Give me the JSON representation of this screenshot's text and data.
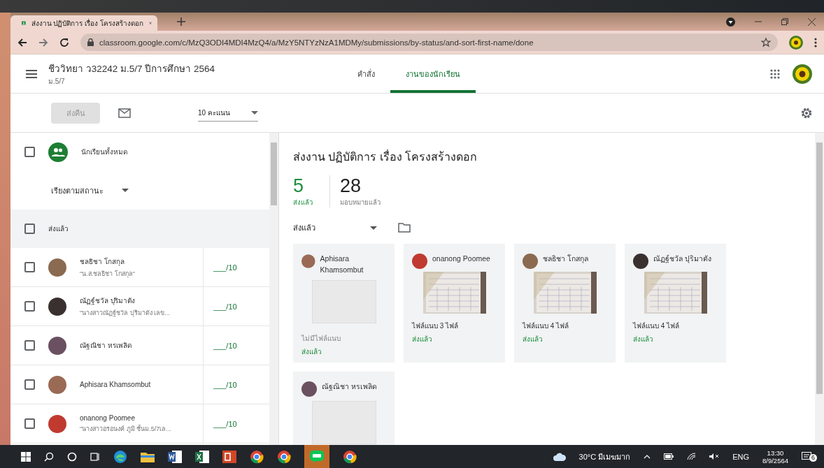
{
  "browser": {
    "tab_title": "ส่งงาน ปฏิบัติการ เรื่อง โครงสร้างดอก",
    "url": "classroom.google.com/c/MzQ3ODI4MDI4MzQ4/a/MzY5NTYzNzA1MDMy/submissions/by-status/and-sort-first-name/done"
  },
  "header": {
    "course_title": "ชีววิทยา ว32242 ม.5/7 ปีการศึกษา 2564",
    "section": "ม.5/7",
    "nav_tabs": [
      {
        "label": "คำสั่ง",
        "selected": false
      },
      {
        "label": "งานของนักเรียน",
        "selected": true
      }
    ]
  },
  "toolbar": {
    "return_button": {
      "label": "ส่งคืน",
      "disabled": true
    },
    "points": "10 คะแนน"
  },
  "students": {
    "all_label": "นักเรียนทั้งหมด",
    "all_checked": false,
    "sort": "เรียงตามสถานะ",
    "group": {
      "label": "ส่งแล้ว",
      "checked": false
    },
    "rows": [
      {
        "name": "ชลธิชา โกสกุล",
        "comment": "\"น.ส.ชลธิชา โกสกุล\"",
        "grade": "___/10",
        "checked": false
      },
      {
        "name": "ณัฏฐ์ชวัล ปุริมาตัง",
        "comment": "\"นางสาวณัฏฐ์ชวัล ปุริมาตัง เลข...",
        "grade": "___/10",
        "checked": false
      },
      {
        "name": "ณัฐณิชา หรเพลิด",
        "grade": "___/10",
        "checked": false
      },
      {
        "name": "Aphisara Khamsombut",
        "grade": "___/10",
        "checked": false
      },
      {
        "name": "onanong Poomee",
        "comment": "\"นางสาวอรอนงค์ ภูมิ ชั้นม.5/7เล...",
        "grade": "___/10",
        "checked": false
      }
    ]
  },
  "assignment": {
    "title": "ส่งงาน ปฏิบัติการ เรื่อง โครงสร้างดอก",
    "stats": [
      {
        "value": "5",
        "label": "ส่งแล้ว",
        "kind": "turned_in"
      },
      {
        "value": "28",
        "label": "มอบหมายแล้ว",
        "kind": "assigned"
      }
    ],
    "filter": "ส่งแล้ว",
    "cards": [
      {
        "name": "Aphisara Khamsombut",
        "kind": "empty",
        "attachments": "ไม่มีไฟล์แนบ",
        "status": "ส่งแล้ว"
      },
      {
        "name": "onanong Poomee",
        "kind": "picture",
        "attachments": "ไฟล์แนบ 3 ไฟล์",
        "status": "ส่งแล้ว"
      },
      {
        "name": "ชลธิชา โกสกุล",
        "kind": "picture",
        "attachments": "ไฟล์แนบ 4 ไฟล์",
        "status": "ส่งแล้ว"
      },
      {
        "name": "ณัฏฐ์ชวัล ปุริมาตัง",
        "kind": "picture",
        "attachments": "ไฟล์แนบ 4 ไฟล์",
        "status": "ส่งแล้ว"
      },
      {
        "name": "ณัฐณิชา หรเพลิด",
        "kind": "empty"
      }
    ]
  },
  "taskbar": {
    "weather": "30°C มีเมฆมาก",
    "language": "ENG",
    "time": "13:30",
    "date": "8/9/2564",
    "notifications": "6"
  }
}
